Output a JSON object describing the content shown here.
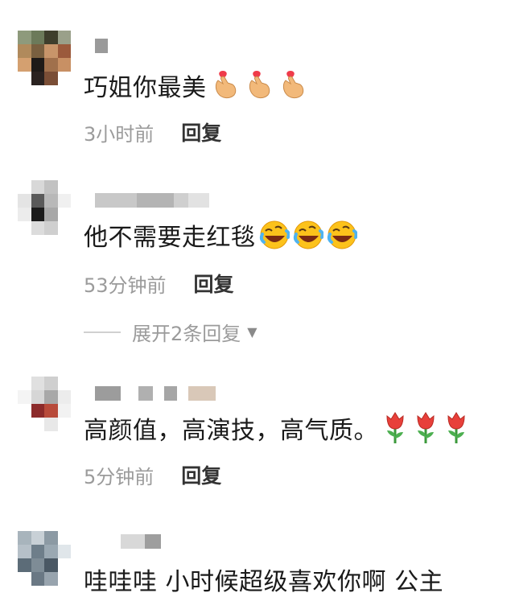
{
  "comments": [
    {
      "text": "巧姐你最美",
      "emoji": "finger-heart-icon",
      "emoji_count": 3,
      "time": "3小时前",
      "reply_label": "回复"
    },
    {
      "text": "他不需要走红毯",
      "emoji": "rolling-laughing-icon",
      "emoji_count": 3,
      "time": "53分钟前",
      "reply_label": "回复",
      "expand_label": "展开2条回复"
    },
    {
      "text": "高颜值，高演技，高气质。",
      "emoji": "tulip-icon",
      "emoji_count": 3,
      "time": "5分钟前",
      "reply_label": "回复"
    },
    {
      "text": "哇哇哇 小时候超级喜欢你啊 公主"
    }
  ]
}
